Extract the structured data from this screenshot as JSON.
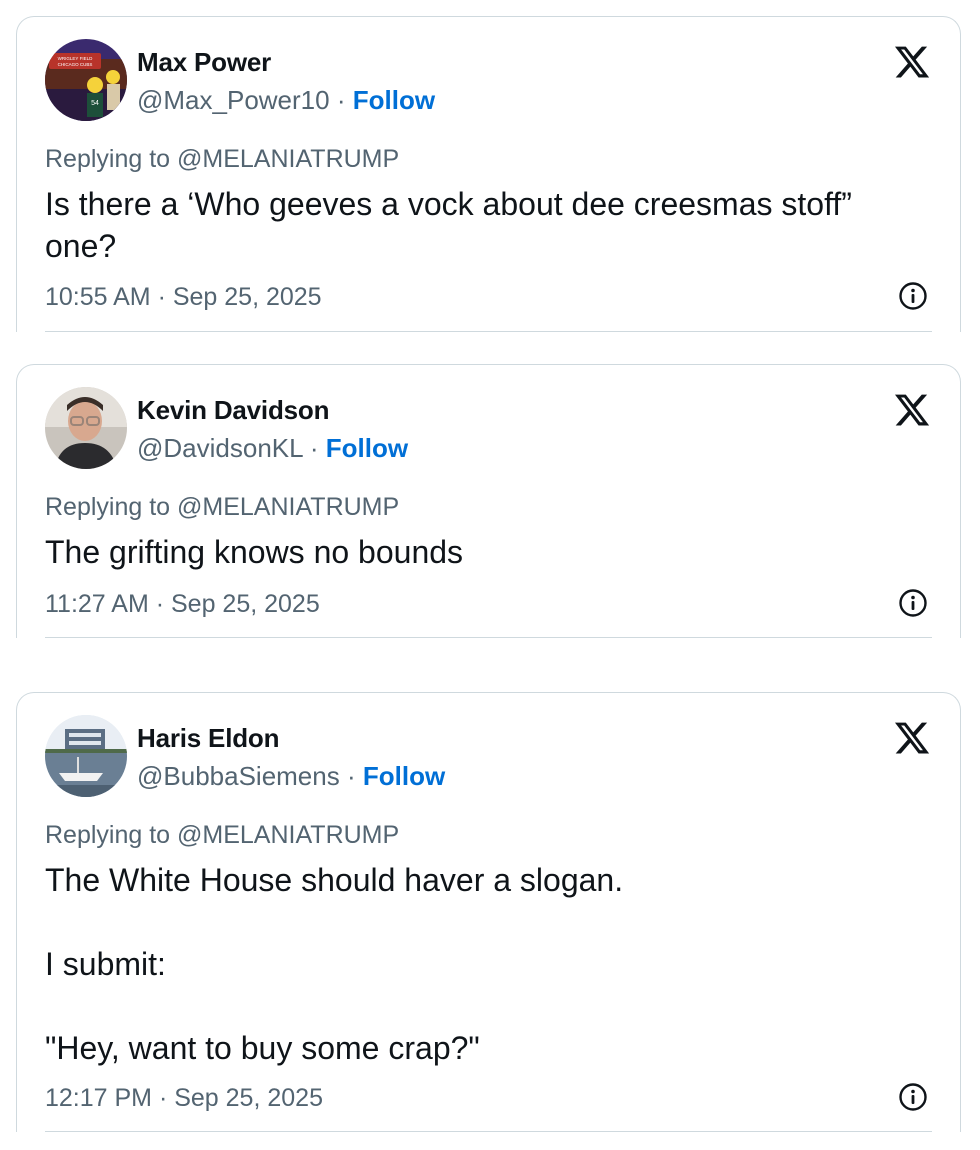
{
  "tweets": [
    {
      "author_name": "Max Power",
      "handle": "@Max_Power10",
      "separator": "·",
      "follow_label": "Follow",
      "replying_to": "Replying to @MELANIATRUMP",
      "text": "Is there a ‘Who geeves a vock about dee creesmas stoff” one?",
      "timestamp": "10:55 AM · Sep 25, 2025",
      "avatar_icon": "avatar-cartoon-icon",
      "avatar_sign_text": "WRIGLEY FIELD HOME OF CHICAGO CUBS",
      "avatar_jersey_number": "54"
    },
    {
      "author_name": "Kevin Davidson",
      "handle": "@DavidsonKL",
      "separator": "·",
      "follow_label": "Follow",
      "replying_to": "Replying to @MELANIATRUMP",
      "text": "The grifting knows no bounds",
      "timestamp": "11:27 AM · Sep 25, 2025",
      "avatar_icon": "avatar-photo-icon"
    },
    {
      "author_name": "Haris Eldon",
      "handle": "@BubbaSiemens",
      "separator": "·",
      "follow_label": "Follow",
      "replying_to": "Replying to @MELANIATRUMP",
      "text": "The White House should haver a slogan.\n\nI submit:\n\n\"Hey, want to buy some crap?\"",
      "timestamp": "12:17 PM · Sep 25, 2025",
      "avatar_icon": "avatar-boat-icon"
    }
  ],
  "colors": {
    "follow": "#006fd6",
    "secondary_text": "#536471",
    "border": "#cfd9de"
  },
  "icons": {
    "brand": "x-logo-icon",
    "info": "info-icon"
  }
}
